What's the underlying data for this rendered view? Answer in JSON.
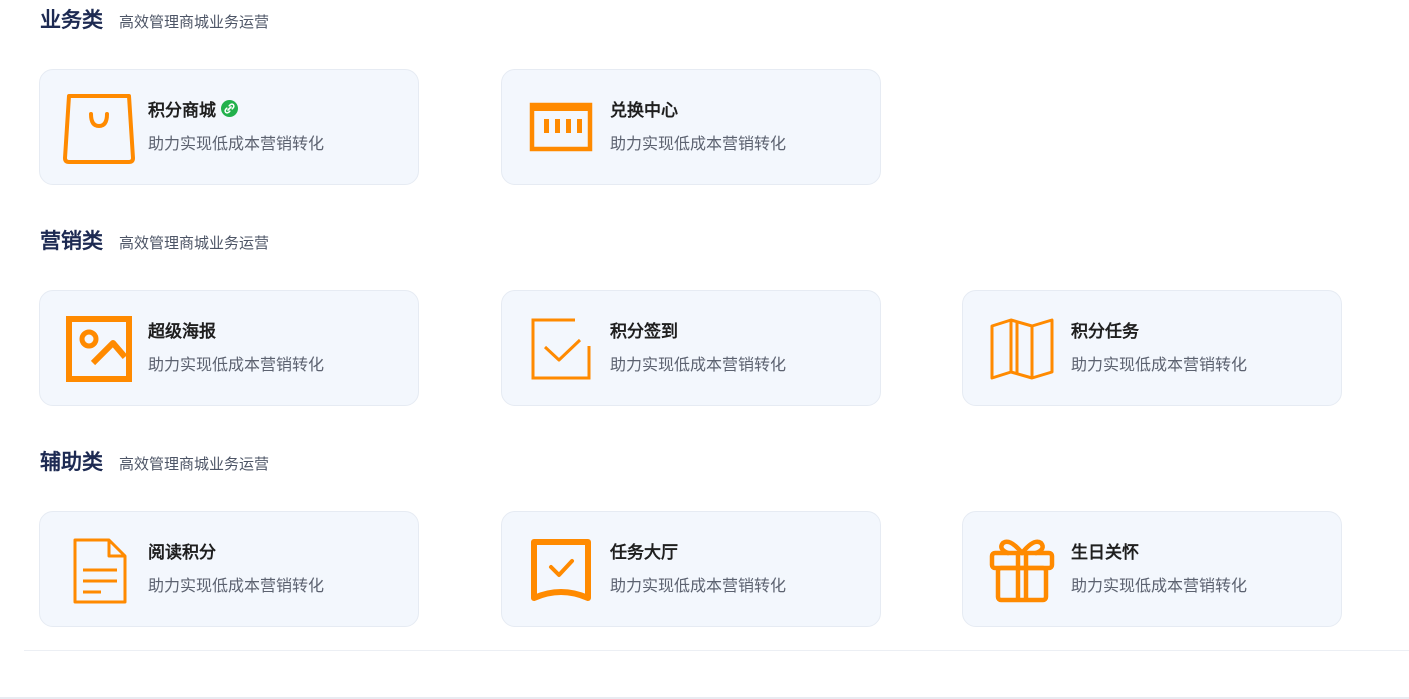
{
  "sections": [
    {
      "title": "业务类",
      "subtitle": "高效管理商城业务运营",
      "cards": [
        {
          "title": "积分商城",
          "desc": "助力实现低成本营销转化",
          "icon": "shopping-bag-icon",
          "has_link_badge": true
        },
        {
          "title": "兑换中心",
          "desc": "助力实现低成本营销转化",
          "icon": "barcode-box-icon"
        }
      ]
    },
    {
      "title": "营销类",
      "subtitle": "高效管理商城业务运营",
      "cards": [
        {
          "title": "超级海报",
          "desc": "助力实现低成本营销转化",
          "icon": "image-poster-icon"
        },
        {
          "title": "积分签到",
          "desc": "助力实现低成本营销转化",
          "icon": "checkmark-box-icon"
        },
        {
          "title": "积分任务",
          "desc": "助力实现低成本营销转化",
          "icon": "folded-map-icon"
        }
      ]
    },
    {
      "title": "辅助类",
      "subtitle": "高效管理商城业务运营",
      "cards": [
        {
          "title": "阅读积分",
          "desc": "助力实现低成本营销转化",
          "icon": "document-icon"
        },
        {
          "title": "任务大厅",
          "desc": "助力实现低成本营销转化",
          "icon": "task-banner-icon"
        },
        {
          "title": "生日关怀",
          "desc": "助力实现低成本营销转化",
          "icon": "gift-icon"
        }
      ]
    }
  ],
  "colors": {
    "accent_orange": "#ff8a00",
    "card_bg": "#f3f7fd",
    "section_title": "#1d2a52",
    "badge_green": "#22b14c"
  }
}
